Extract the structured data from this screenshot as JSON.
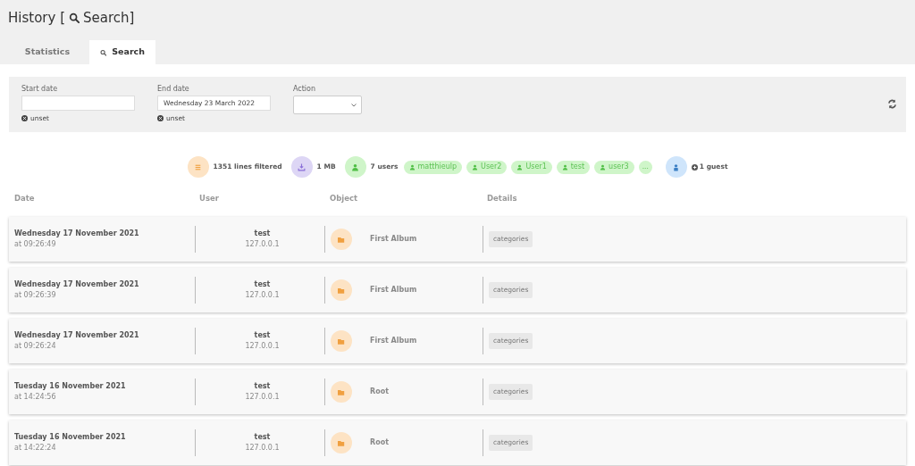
{
  "title": {
    "prefix": "History [",
    "label": "Search]"
  },
  "tabs": [
    {
      "label": "Statistics",
      "kind": "stats",
      "selected": false
    },
    {
      "label": "Search",
      "kind": "search",
      "selected": true
    }
  ],
  "filters": {
    "start_date": {
      "label": "Start date",
      "unset": "unset"
    },
    "end_date": {
      "label": "End date",
      "value": "Wednesday 23 March 2022",
      "unset": "unset"
    },
    "action": {
      "label": "Action"
    }
  },
  "summary": {
    "lines": "1351 lines filtered",
    "size": "1 MB",
    "users": "7 users",
    "user_tags": [
      "matthieulp",
      "User2",
      "User1",
      "test",
      "user3"
    ],
    "more": "...",
    "guests": "1 guest"
  },
  "table": {
    "columns": [
      "Date",
      "User",
      "Object",
      "Details"
    ],
    "rows": [
      {
        "date": "Wednesday 17 November 2021",
        "time": "at 09:26:49",
        "user": "test",
        "ip": "127.0.0.1",
        "object": "First Album",
        "details": "categories"
      },
      {
        "date": "Wednesday 17 November 2021",
        "time": "at 09:26:39",
        "user": "test",
        "ip": "127.0.0.1",
        "object": "First Album",
        "details": "categories"
      },
      {
        "date": "Wednesday 17 November 2021",
        "time": "at 09:26:24",
        "user": "test",
        "ip": "127.0.0.1",
        "object": "First Album",
        "details": "categories"
      },
      {
        "date": "Tuesday 16 November 2021",
        "time": "at 14:24:56",
        "user": "test",
        "ip": "127.0.0.1",
        "object": "Root",
        "details": "categories"
      },
      {
        "date": "Tuesday 16 November 2021",
        "time": "at 14:22:24",
        "user": "test",
        "ip": "127.0.0.1",
        "object": "Root",
        "details": "categories"
      }
    ]
  }
}
